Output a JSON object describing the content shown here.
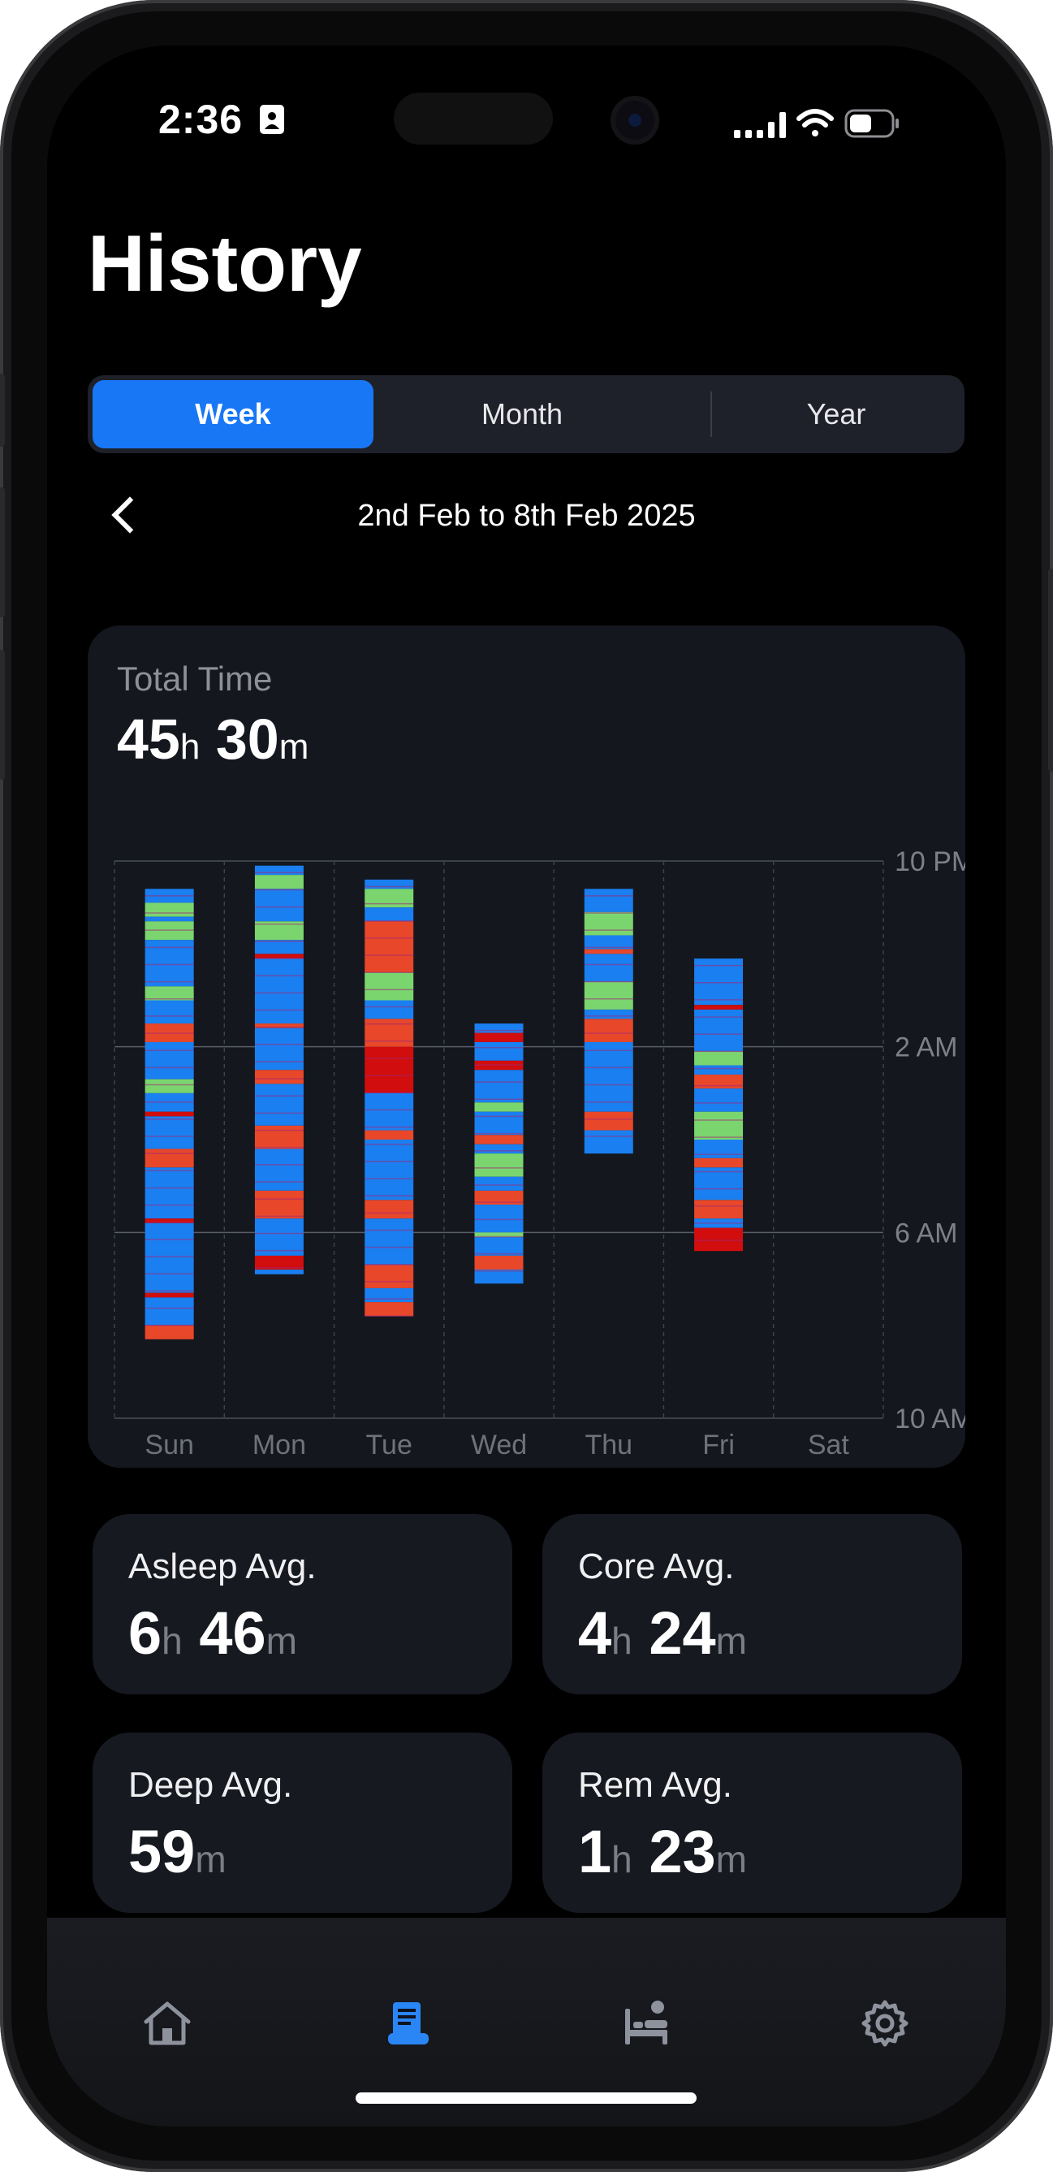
{
  "status_bar": {
    "time": "2:36"
  },
  "header": {
    "title": "History"
  },
  "segments": {
    "items": [
      "Week",
      "Month",
      "Year"
    ],
    "selected": "Week"
  },
  "date_range": "2nd Feb to 8th Feb 2025",
  "total_time": {
    "label": "Total Time",
    "hours": "45",
    "minutes": "30",
    "h_unit": "h",
    "m_unit": "m"
  },
  "chart_data": {
    "type": "bar",
    "categories": [
      "Sun",
      "Mon",
      "Tue",
      "Wed",
      "Thu",
      "Fri",
      "Sat"
    ],
    "y_ticks": [
      "10 PM",
      "2 AM",
      "6 AM",
      "10 AM"
    ],
    "ylim_hours_after_10pm": [
      0,
      12
    ],
    "stage_colors": {
      "core": "#1a7ff0",
      "deep": "#e8472a",
      "rem": "#7bd56f",
      "awake": "#d10d0d"
    },
    "series": [
      {
        "day": "Sun",
        "start": 0.6,
        "end": 10.3,
        "segments": [
          [
            "core",
            0.6,
            0.9
          ],
          [
            "rem",
            0.9,
            1.2
          ],
          [
            "core",
            1.2,
            1.3
          ],
          [
            "rem",
            1.3,
            1.7
          ],
          [
            "core",
            1.7,
            2.7
          ],
          [
            "rem",
            2.7,
            3.0
          ],
          [
            "core",
            3.0,
            3.5
          ],
          [
            "deep",
            3.5,
            3.9
          ],
          [
            "core",
            3.9,
            4.7
          ],
          [
            "rem",
            4.7,
            5.0
          ],
          [
            "core",
            5.0,
            5.4
          ],
          [
            "awake",
            5.4,
            5.5
          ],
          [
            "core",
            5.5,
            6.2
          ],
          [
            "deep",
            6.2,
            6.6
          ],
          [
            "core",
            6.6,
            7.7
          ],
          [
            "awake",
            7.7,
            7.8
          ],
          [
            "core",
            7.8,
            9.3
          ],
          [
            "awake",
            9.3,
            9.4
          ],
          [
            "core",
            9.4,
            10.0
          ],
          [
            "deep",
            10.0,
            10.3
          ]
        ]
      },
      {
        "day": "Mon",
        "start": 0.1,
        "end": 8.9,
        "segments": [
          [
            "core",
            0.1,
            0.3
          ],
          [
            "rem",
            0.3,
            0.6
          ],
          [
            "core",
            0.6,
            1.3
          ],
          [
            "rem",
            1.3,
            1.7
          ],
          [
            "core",
            1.7,
            2.0
          ],
          [
            "awake",
            2.0,
            2.1
          ],
          [
            "core",
            2.1,
            3.5
          ],
          [
            "deep",
            3.5,
            3.6
          ],
          [
            "core",
            3.6,
            4.5
          ],
          [
            "deep",
            4.5,
            4.8
          ],
          [
            "core",
            4.8,
            5.7
          ],
          [
            "deep",
            5.7,
            6.2
          ],
          [
            "core",
            6.2,
            7.1
          ],
          [
            "deep",
            7.1,
            7.7
          ],
          [
            "core",
            7.7,
            8.5
          ],
          [
            "awake",
            8.5,
            8.8
          ],
          [
            "core",
            8.8,
            8.9
          ]
        ]
      },
      {
        "day": "Tue",
        "start": 0.4,
        "end": 9.8,
        "segments": [
          [
            "core",
            0.4,
            0.6
          ],
          [
            "rem",
            0.6,
            1.0
          ],
          [
            "core",
            1.0,
            1.3
          ],
          [
            "deep",
            1.3,
            2.4
          ],
          [
            "rem",
            2.4,
            3.0
          ],
          [
            "core",
            3.0,
            3.4
          ],
          [
            "deep",
            3.4,
            4.0
          ],
          [
            "awake",
            4.0,
            5.0
          ],
          [
            "core",
            5.0,
            5.8
          ],
          [
            "deep",
            5.8,
            6.0
          ],
          [
            "core",
            6.0,
            7.3
          ],
          [
            "deep",
            7.3,
            7.7
          ],
          [
            "core",
            7.7,
            8.7
          ],
          [
            "deep",
            8.7,
            9.2
          ],
          [
            "core",
            9.2,
            9.5
          ],
          [
            "deep",
            9.5,
            9.8
          ]
        ]
      },
      {
        "day": "Wed",
        "start": 3.5,
        "end": 9.1,
        "segments": [
          [
            "core",
            3.5,
            3.7
          ],
          [
            "awake",
            3.7,
            3.9
          ],
          [
            "core",
            3.9,
            4.3
          ],
          [
            "awake",
            4.3,
            4.5
          ],
          [
            "core",
            4.5,
            5.2
          ],
          [
            "rem",
            5.2,
            5.4
          ],
          [
            "core",
            5.4,
            5.9
          ],
          [
            "deep",
            5.9,
            6.1
          ],
          [
            "core",
            6.1,
            6.3
          ],
          [
            "rem",
            6.3,
            6.8
          ],
          [
            "core",
            6.8,
            7.1
          ],
          [
            "deep",
            7.1,
            7.4
          ],
          [
            "core",
            7.4,
            8.0
          ],
          [
            "rem",
            8.0,
            8.1
          ],
          [
            "core",
            8.1,
            8.5
          ],
          [
            "deep",
            8.5,
            8.8
          ],
          [
            "core",
            8.8,
            9.1
          ]
        ]
      },
      {
        "day": "Thu",
        "start": 0.6,
        "end": 6.3,
        "segments": [
          [
            "core",
            0.6,
            1.1
          ],
          [
            "rem",
            1.1,
            1.6
          ],
          [
            "core",
            1.6,
            1.9
          ],
          [
            "deep",
            1.9,
            2.0
          ],
          [
            "core",
            2.0,
            2.6
          ],
          [
            "rem",
            2.6,
            3.2
          ],
          [
            "core",
            3.2,
            3.4
          ],
          [
            "deep",
            3.4,
            3.9
          ],
          [
            "core",
            3.9,
            5.4
          ],
          [
            "deep",
            5.4,
            5.8
          ],
          [
            "core",
            5.8,
            6.3
          ]
        ]
      },
      {
        "day": "Fri",
        "start": 2.1,
        "end": 8.4,
        "segments": [
          [
            "core",
            2.1,
            3.1
          ],
          [
            "awake",
            3.1,
            3.2
          ],
          [
            "core",
            3.2,
            4.1
          ],
          [
            "rem",
            4.1,
            4.4
          ],
          [
            "core",
            4.4,
            4.6
          ],
          [
            "deep",
            4.6,
            4.9
          ],
          [
            "core",
            4.9,
            5.4
          ],
          [
            "rem",
            5.4,
            6.0
          ],
          [
            "core",
            6.0,
            6.4
          ],
          [
            "deep",
            6.4,
            6.6
          ],
          [
            "core",
            6.6,
            7.3
          ],
          [
            "deep",
            7.3,
            7.7
          ],
          [
            "core",
            7.7,
            7.9
          ],
          [
            "awake",
            7.9,
            8.4
          ]
        ]
      },
      {
        "day": "Sat",
        "start": null,
        "end": null,
        "segments": []
      }
    ]
  },
  "stats": [
    {
      "label": "Asleep Avg.",
      "h": "6",
      "m": "46"
    },
    {
      "label": "Core Avg.",
      "h": "4",
      "m": "24"
    },
    {
      "label": "Deep Avg.",
      "h": "",
      "m": "59"
    },
    {
      "label": "Rem Avg.",
      "h": "1",
      "m": "23"
    }
  ],
  "units": {
    "h": "h",
    "m": "m"
  },
  "tabs": [
    "home-icon",
    "history-icon",
    "sleep-ai-icon",
    "gear-icon"
  ],
  "active_tab": "history-icon"
}
